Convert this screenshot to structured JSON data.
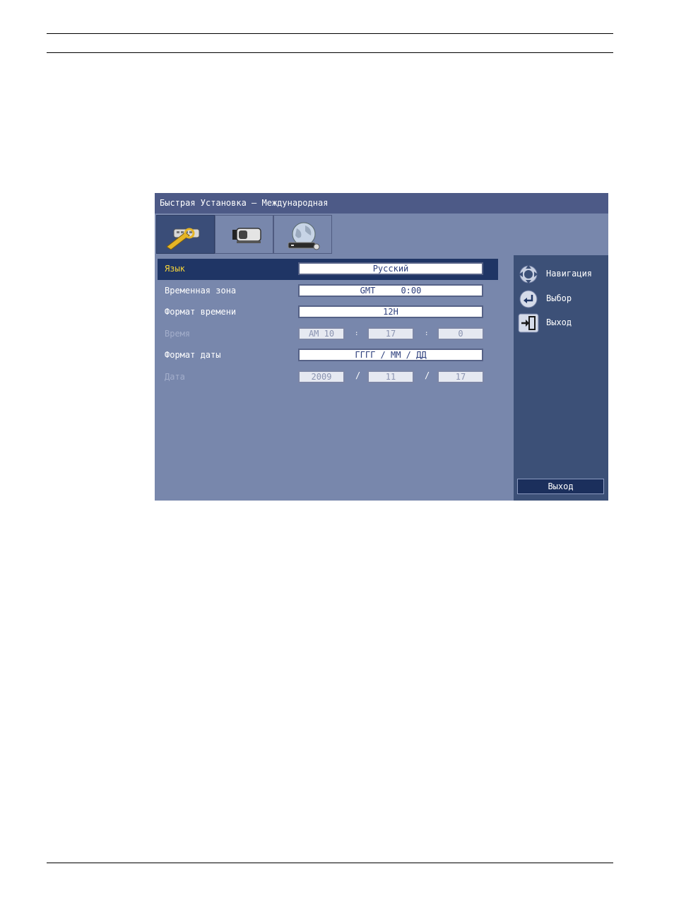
{
  "window": {
    "title": "Быстрая Установка – Международная"
  },
  "tabs": [
    {
      "name": "Установки",
      "icon": "wrench-keyboard-icon",
      "active": true
    },
    {
      "name": "Камеры",
      "icon": "camera-icon",
      "active": false
    },
    {
      "name": "Сеть",
      "icon": "globe-network-icon",
      "active": false
    }
  ],
  "settings": {
    "language": {
      "label": "Язык",
      "value": "Русский"
    },
    "timezone": {
      "label": "Временная зона",
      "value": "GMT     0:00"
    },
    "time_format": {
      "label": "Формат времени",
      "value": "12H"
    },
    "time": {
      "label": "Время",
      "hour": "AM 10",
      "minute": "17",
      "second": "0",
      "separator": ":"
    },
    "date_format": {
      "label": "Формат даты",
      "value": "ГГГГ / ММ / ДД"
    },
    "date": {
      "label": "Дата",
      "year": "2009",
      "month": "11",
      "day": "17",
      "separator": "/"
    }
  },
  "side_panel": {
    "hints": [
      {
        "icon": "dpad-icon",
        "label": "Навигация"
      },
      {
        "icon": "enter-icon",
        "label": "Выбор"
      },
      {
        "icon": "exit-icon",
        "label": "Выход"
      }
    ],
    "exit_button": "Выход"
  },
  "colors": {
    "screen_bg": "#7887ac",
    "title_bar": "#4d5a87",
    "selection": "#1f3565",
    "selected_text": "#f3d23a",
    "side_panel": "#3c5077"
  }
}
